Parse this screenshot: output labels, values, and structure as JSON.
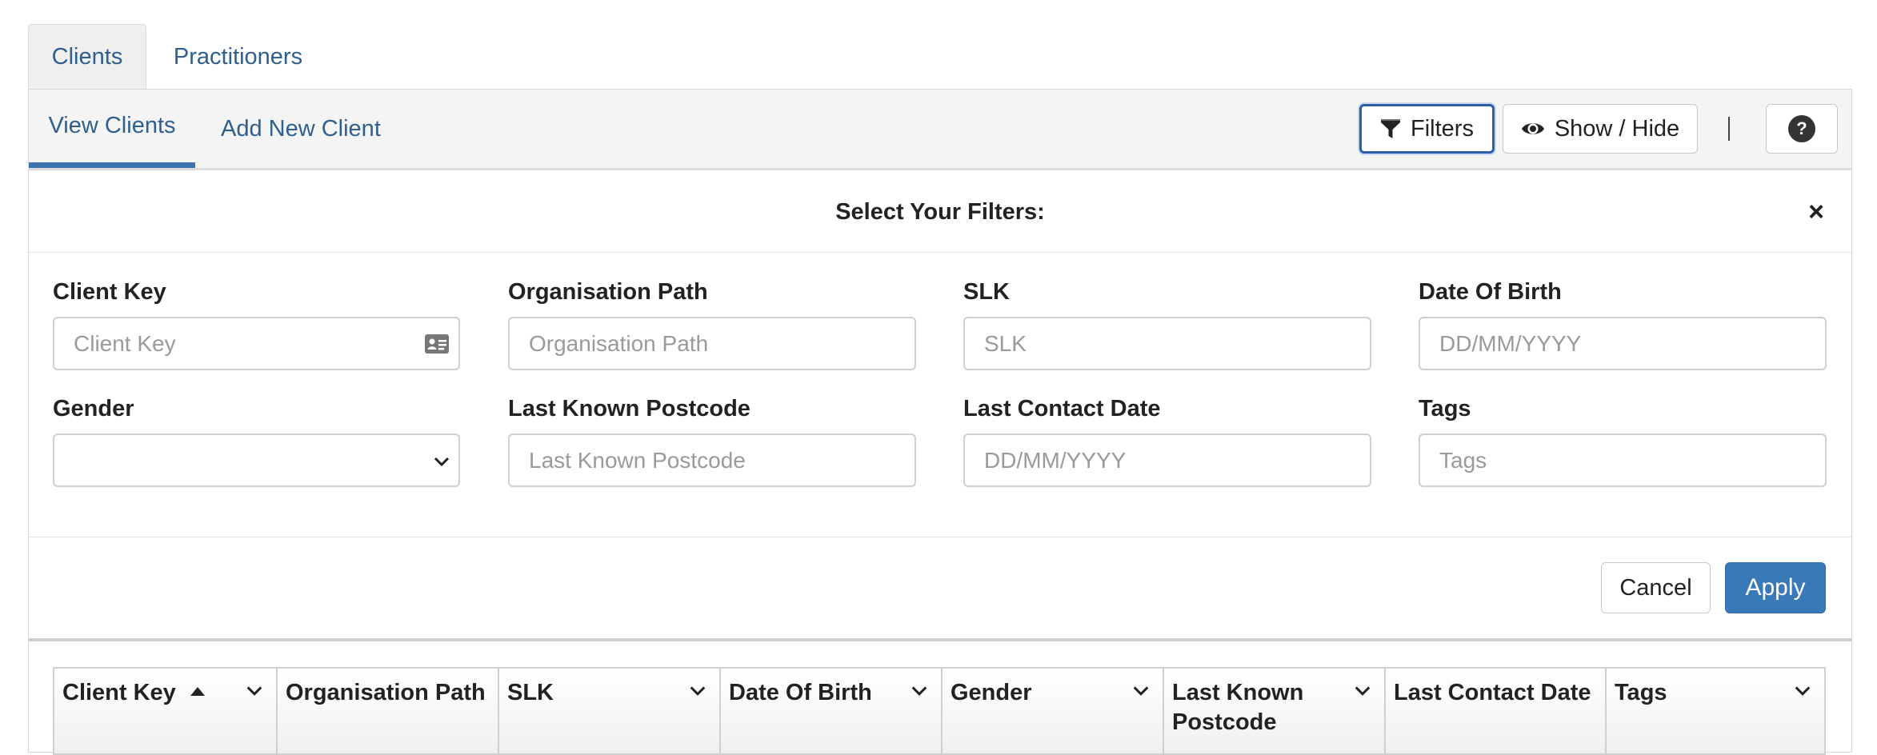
{
  "top_tabs": [
    {
      "label": "Clients",
      "active": true
    },
    {
      "label": "Practitioners",
      "active": false
    }
  ],
  "sub_tabs": [
    {
      "label": "View Clients",
      "active": true
    },
    {
      "label": "Add New Client",
      "active": false
    }
  ],
  "toolbar": {
    "filters_label": "Filters",
    "show_hide_label": "Show / Hide",
    "help_label": "?"
  },
  "filter_panel": {
    "title": "Select Your Filters:",
    "close_glyph": "×",
    "fields": [
      {
        "label": "Client Key",
        "placeholder": "Client Key",
        "type": "text",
        "icon": "id-card-icon"
      },
      {
        "label": "Organisation Path",
        "placeholder": "Organisation Path",
        "type": "text"
      },
      {
        "label": "SLK",
        "placeholder": "SLK",
        "type": "text"
      },
      {
        "label": "Date Of Birth",
        "placeholder": "DD/MM/YYYY",
        "type": "text"
      },
      {
        "label": "Gender",
        "placeholder": "",
        "type": "select",
        "value": ""
      },
      {
        "label": "Last Known Postcode",
        "placeholder": "Last Known Postcode",
        "type": "text"
      },
      {
        "label": "Last Contact Date",
        "placeholder": "DD/MM/YYYY",
        "type": "text"
      },
      {
        "label": "Tags",
        "placeholder": "Tags",
        "type": "text"
      }
    ],
    "cancel_label": "Cancel",
    "apply_label": "Apply"
  },
  "table": {
    "columns": [
      {
        "label": "Client Key",
        "sorted": "asc",
        "menu": true
      },
      {
        "label": "Organisation Path",
        "menu": false
      },
      {
        "label": "SLK",
        "menu": true
      },
      {
        "label": "Date Of Birth",
        "menu": true
      },
      {
        "label": "Gender",
        "menu": true
      },
      {
        "label": "Last Known Postcode",
        "menu": true
      },
      {
        "label": "Last Contact Date",
        "menu": false
      },
      {
        "label": "Tags",
        "menu": true
      }
    ]
  },
  "colors": {
    "link": "#2e5f8f",
    "primary": "#3a79b8",
    "focus_border": "#2d5fa6"
  }
}
